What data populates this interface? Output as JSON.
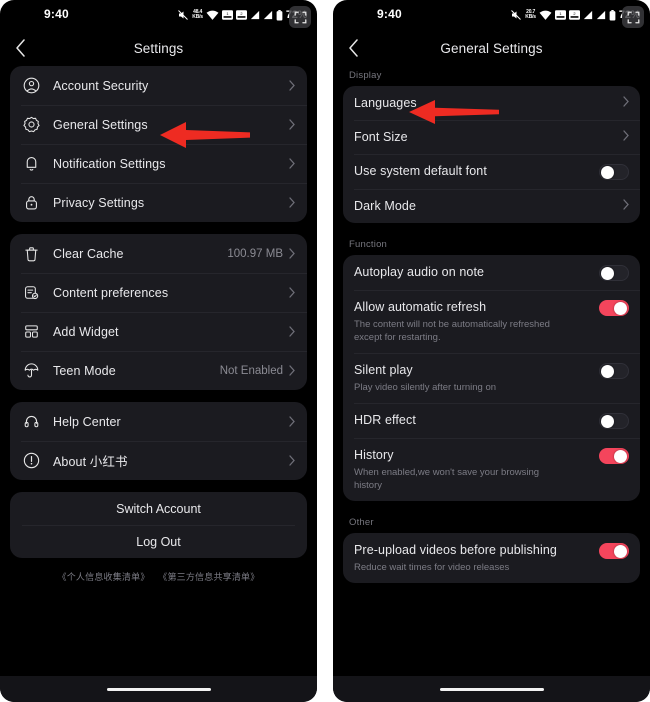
{
  "left_phone": {
    "statusbar": {
      "time": "9:40",
      "net_speed_value": "48.4",
      "net_speed_unit": "KB/s",
      "battery_percent": "72%",
      "icons": [
        "mute-icon",
        "network-speed-icon",
        "wifi-icon",
        "sim1-icon",
        "sim2-icon",
        "signal1-icon",
        "signal2-icon",
        "battery-icon"
      ],
      "screenshot_button": "screenshot-icon"
    },
    "navbar": {
      "title": "Settings",
      "back": "back-chevron-icon"
    },
    "group1": [
      {
        "icon": "account-circle-icon",
        "label": "Account Security",
        "value": ""
      },
      {
        "icon": "gear-icon",
        "label": "General Settings",
        "value": ""
      },
      {
        "icon": "bell-icon",
        "label": "Notification Settings",
        "value": ""
      },
      {
        "icon": "lock-icon",
        "label": "Privacy Settings",
        "value": ""
      }
    ],
    "group2": [
      {
        "icon": "trash-icon",
        "label": "Clear Cache",
        "value": "100.97 MB"
      },
      {
        "icon": "content-preferences-icon",
        "label": "Content preferences",
        "value": ""
      },
      {
        "icon": "widget-icon",
        "label": "Add Widget",
        "value": ""
      },
      {
        "icon": "umbrella-icon",
        "label": "Teen Mode",
        "value": "Not Enabled"
      }
    ],
    "group3": [
      {
        "icon": "headset-icon",
        "label": "Help Center",
        "value": ""
      },
      {
        "icon": "info-circle-icon",
        "label": "About 小红书",
        "value": ""
      }
    ],
    "actions": [
      {
        "label": "Switch Account"
      },
      {
        "label": "Log Out"
      }
    ],
    "footer_links": [
      "《个人信息收集清单》",
      "《第三方信息共享清单》"
    ]
  },
  "right_phone": {
    "statusbar": {
      "time": "9:40",
      "net_speed_value": "20.7",
      "net_speed_unit": "KB/s",
      "battery_percent": "72%"
    },
    "navbar": {
      "title": "General Settings",
      "back": "back-chevron-icon"
    },
    "sections": [
      {
        "label": "Display",
        "rows": [
          {
            "title": "Languages",
            "sub": "",
            "control": "chevron"
          },
          {
            "title": "Font Size",
            "sub": "",
            "control": "chevron"
          },
          {
            "title": "Use system default font",
            "sub": "",
            "control": "toggle",
            "on": false
          },
          {
            "title": "Dark Mode",
            "sub": "",
            "control": "chevron"
          }
        ]
      },
      {
        "label": "Function",
        "rows": [
          {
            "title": "Autoplay audio on note",
            "sub": "",
            "control": "toggle",
            "on": false
          },
          {
            "title": "Allow automatic refresh",
            "sub": "The content will not be automatically refreshed except for restarting.",
            "control": "toggle",
            "on": true
          },
          {
            "title": "Silent play",
            "sub": "Play video silently after turning on",
            "control": "toggle",
            "on": false
          },
          {
            "title": "HDR effect",
            "sub": "",
            "control": "toggle",
            "on": false
          },
          {
            "title": "History",
            "sub": "When enabled,we won't save your browsing history",
            "control": "toggle",
            "on": true
          }
        ]
      },
      {
        "label": "Other",
        "rows": [
          {
            "title": "Pre-upload videos before publishing",
            "sub": "Reduce wait times for video releases",
            "control": "toggle",
            "on": true
          }
        ]
      }
    ]
  },
  "annotations": [
    {
      "name": "arrow-general-settings",
      "color": "#ee2b22"
    },
    {
      "name": "arrow-languages",
      "color": "#ee2b22"
    }
  ],
  "colors": {
    "card_bg": "#1b1b20",
    "phone_bg": "#000000",
    "accent_red": "#f4455c",
    "arrow_red": "#ee2b22",
    "text_primary": "#e8e8eb",
    "text_secondary": "#7c7c85"
  }
}
